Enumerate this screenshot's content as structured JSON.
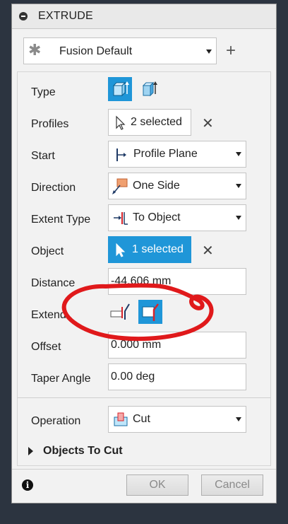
{
  "dialog": {
    "title": "EXTRUDE",
    "preset": "Fusion Default",
    "plus_icon": "plus-icon"
  },
  "rows": {
    "type": {
      "label": "Type"
    },
    "profiles": {
      "label": "Profiles",
      "value": "2 selected"
    },
    "start": {
      "label": "Start",
      "value": "Profile Plane"
    },
    "direction": {
      "label": "Direction",
      "value": "One Side"
    },
    "extent_type": {
      "label": "Extent Type",
      "value": "To Object"
    },
    "object": {
      "label": "Object",
      "value": "1 selected"
    },
    "distance": {
      "label": "Distance",
      "value": "-44.606 mm"
    },
    "extend": {
      "label": "Extend"
    },
    "offset": {
      "label": "Offset",
      "value": "0.000 mm"
    },
    "taper_angle": {
      "label": "Taper Angle",
      "value": "0.00 deg"
    },
    "operation": {
      "label": "Operation",
      "value": "Cut"
    }
  },
  "section": {
    "objects_to_cut": "Objects To Cut"
  },
  "footer": {
    "ok": "OK",
    "cancel": "Cancel"
  },
  "colors": {
    "accent": "#1f96d8",
    "annotation": "#e0191b",
    "background": "#2c3440"
  }
}
